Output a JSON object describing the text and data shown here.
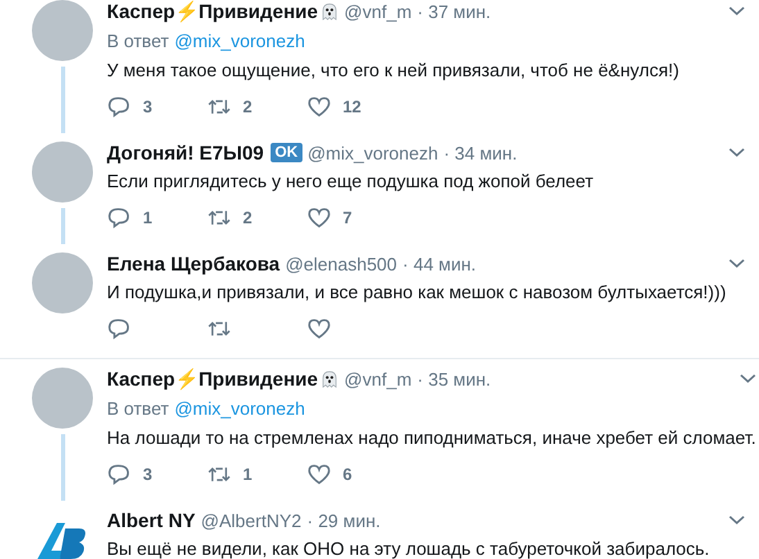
{
  "threads": [
    {
      "tweets": [
        {
          "avatar": {
            "kind": "photo"
          },
          "name": "Каспер⚡Привидение",
          "ghost_icon": true,
          "handle": "@vnf_m",
          "time": "· 37 мин.",
          "reply_label": "В ответ",
          "reply_to": "@mix_voronezh",
          "text": "У меня такое ощущение, что его к ней привязали, чтоб не ё&нулся!)",
          "replies": "3",
          "retweets": "2",
          "likes": "12"
        },
        {
          "avatar": {
            "kind": "photo"
          },
          "name": "Догоняй! Е7Ы09",
          "ghost_icon": false,
          "badge": "OK",
          "handle": "@mix_voronezh",
          "time": "· 34 мин.",
          "text": "Если приглядитесь у него еще подушка под жопой белеет",
          "replies": "1",
          "retweets": "2",
          "likes": "7"
        },
        {
          "avatar": {
            "kind": "photo"
          },
          "name": "Елена Щербакова",
          "ghost_icon": false,
          "handle": "@elenash500",
          "time": "· 44 мин.",
          "text": "И подушка,и привязали, и все равно как мешок с навозом бултыхается!)))"
        }
      ]
    },
    {
      "tweets": [
        {
          "avatar": {
            "kind": "photo"
          },
          "name": "Каспер⚡Привидение",
          "ghost_icon": true,
          "handle": "@vnf_m",
          "time": "· 35 мин.",
          "reply_label": "В ответ",
          "reply_to": "@mix_voronezh",
          "text": "На лошади то на стремленах надо пиподниматься, иначе хребет ей сломает.",
          "replies": "3",
          "retweets": "1",
          "likes": "6"
        },
        {
          "avatar": {
            "kind": "logo"
          },
          "name": "Albert NY",
          "ghost_icon": false,
          "handle": "@AlbertNY2",
          "time": "· 29 мин.",
          "text": "Вы ещё не видели, как ОНО на эту лошадь с табуреточкой забиралось."
        }
      ]
    }
  ]
}
